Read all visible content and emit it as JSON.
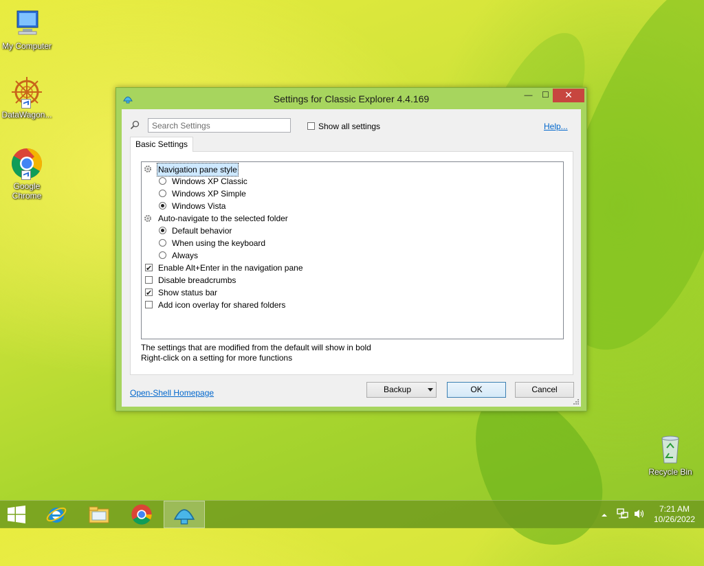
{
  "desktop": {
    "icons": [
      {
        "label": "My Computer"
      },
      {
        "label": "DataWagon..."
      },
      {
        "label": "Google Chrome"
      },
      {
        "label": "Recycle Bin"
      }
    ]
  },
  "window": {
    "title": "Settings for Classic Explorer 4.4.169",
    "minimize": "—",
    "maximize": "☐",
    "close": "✕",
    "search": {
      "placeholder": "Search Settings",
      "value": ""
    },
    "show_all_label": "Show all settings",
    "show_all_checked": false,
    "help_link": "Help...",
    "tab_label": "Basic Settings",
    "tree": {
      "nav_pane_style": "Navigation pane style",
      "nav_options": [
        "Windows XP Classic",
        "Windows XP Simple",
        "Windows Vista"
      ],
      "nav_selected": "Windows Vista",
      "autonav": "Auto-navigate to the selected folder",
      "autonav_options": [
        "Default behavior",
        "When using the keyboard",
        "Always"
      ],
      "autonav_selected": "Default behavior",
      "checks": [
        {
          "label": "Enable Alt+Enter in the navigation pane",
          "checked": true
        },
        {
          "label": "Disable breadcrumbs",
          "checked": false
        },
        {
          "label": "Show status bar",
          "checked": true
        },
        {
          "label": "Add icon overlay for shared folders",
          "checked": false
        }
      ]
    },
    "footnote_1": "The settings that are modified from the default will show in bold",
    "footnote_2": "Right-click on a setting for more functions",
    "homepage_link": "Open-Shell Homepage",
    "buttons": {
      "backup": "Backup",
      "ok": "OK",
      "cancel": "Cancel"
    }
  },
  "taskbar": {
    "items": [
      "start",
      "internet-explorer",
      "file-explorer",
      "chrome",
      "classic-explorer-settings"
    ],
    "active": "classic-explorer-settings",
    "time": "7:21 AM",
    "date": "10/26/2022"
  },
  "colors": {
    "accent_green": "#a7d55e",
    "close_red": "#c7463f",
    "link_blue": "#0066cc"
  }
}
